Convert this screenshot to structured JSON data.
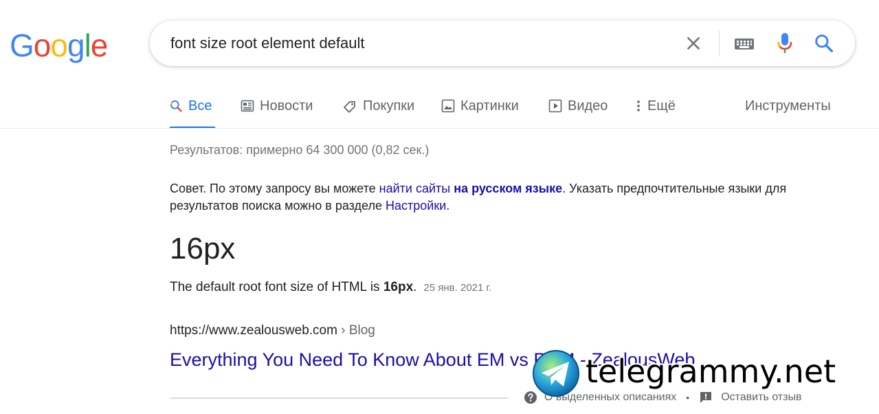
{
  "logo": {
    "letters": [
      "G",
      "o",
      "o",
      "g",
      "l",
      "e"
    ],
    "colors": [
      "#4285f4",
      "#ea4335",
      "#fbbc05",
      "#4285f4",
      "#34a853",
      "#ea4335"
    ]
  },
  "search": {
    "query": "font size root element default"
  },
  "tabs": [
    {
      "label": "Все",
      "icon": "search-icon",
      "active": true
    },
    {
      "label": "Новости",
      "icon": "news-icon"
    },
    {
      "label": "Покупки",
      "icon": "tag-icon"
    },
    {
      "label": "Картинки",
      "icon": "image-icon"
    },
    {
      "label": "Видео",
      "icon": "play-icon"
    },
    {
      "label": "Ещё",
      "icon": "more-icon"
    }
  ],
  "tools_label": "Инструменты",
  "stats": "Результатов: примерно 64 300 000 (0,82 сек.)",
  "tip": {
    "prefix": "Совет. По этому запросу вы можете ",
    "link1": "найти сайты",
    "link2": "на русском языке",
    "middle": ". Указать предпочтительные языки для результатов поиска можно в разделе ",
    "link3": "Настройки",
    "suffix": "."
  },
  "answer": "16px",
  "snippet": {
    "prefix": "The default root font size of HTML is ",
    "bold": "16px",
    "suffix": ".",
    "date": "25 янв. 2021 г."
  },
  "result": {
    "url": "https://www.zealousweb.com",
    "breadcrumb": " › Blog",
    "title": "Everything You Need To Know About EM vs REM - ZealousWeb"
  },
  "feedback": {
    "about": "О выделенных описаниях",
    "separator": "•",
    "leave": "Оставить отзыв"
  },
  "watermark": {
    "text": "telegrammy.net"
  },
  "colors": {
    "link": "#1a0dab",
    "accent": "#1a73e8",
    "muted": "#70757a"
  }
}
